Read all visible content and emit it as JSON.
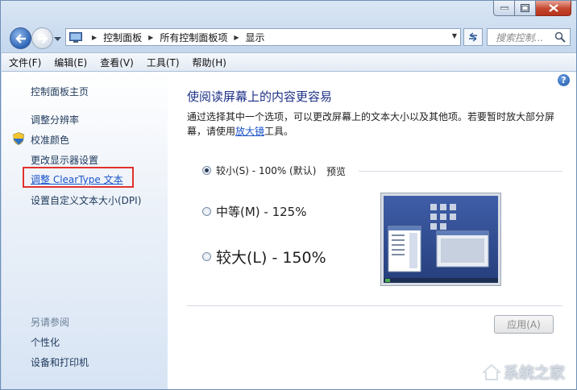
{
  "window": {
    "address": [
      "控制面板",
      "所有控制面板项",
      "显示"
    ],
    "search_placeholder": "搜索控制..."
  },
  "menubar": [
    "文件(F)",
    "编辑(E)",
    "查看(V)",
    "工具(T)",
    "帮助(H)"
  ],
  "left": {
    "home": "控制面板主页",
    "links": [
      "调整分辨率",
      "校准颜色",
      "更改显示器设置",
      "调整 ClearType 文本",
      "设置自定义文本大小(DPI)"
    ],
    "see_also_title": "另请参阅",
    "see_also": [
      "个性化",
      "设备和打印机"
    ]
  },
  "main": {
    "title": "使阅读屏幕上的内容更容易",
    "desc_part1": "通过选择其中一个选项，可以更改屏幕上的文本大小以及其他项。若要暂时放大部分屏幕，请使用",
    "desc_link": "放大镜",
    "desc_part2": "工具。",
    "options": [
      {
        "label": "较小(S) - 100% (默认)",
        "checked": true
      },
      {
        "label": "中等(M) - 125%",
        "checked": false
      },
      {
        "label": "较大(L) - 150%",
        "checked": false
      }
    ],
    "preview_label": "预览",
    "apply": "应用(A)"
  },
  "watermark": "系统之家",
  "colors": {
    "accent_title": "#1e3287",
    "link": "#1a54c8",
    "highlight": "#e0322e"
  }
}
